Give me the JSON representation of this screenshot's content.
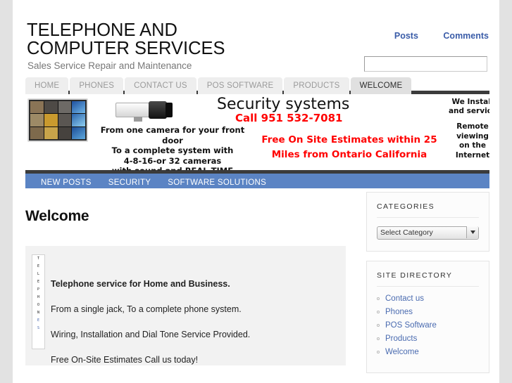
{
  "site": {
    "title": "TELEPHONE AND COMPUTER SERVICES",
    "tagline": "Sales Service Repair and Maintenance"
  },
  "meta_nav": {
    "posts": "Posts",
    "comments": "Comments"
  },
  "search": {
    "value": "",
    "placeholder": ""
  },
  "primary_nav": {
    "items": [
      {
        "label": "HOME",
        "active": false
      },
      {
        "label": "PHONES",
        "active": false
      },
      {
        "label": "CONTACT US",
        "active": false
      },
      {
        "label": "POS SOFTWARE",
        "active": false
      },
      {
        "label": "PRODUCTS",
        "active": false
      },
      {
        "label": "WELCOME",
        "active": true
      }
    ]
  },
  "banner": {
    "heading": "Security systems",
    "call": "Call 951 532-7081",
    "left_text": "From one camera for your front door\nTo a complete system with\n4-8-16-or 32 cameras\nwith sound and REAL TIME recording",
    "offer": "Free On Site Estimates within 25 Miles from Ontario California",
    "right_top": "We Install\nand service",
    "right_bottom": "Remote\nviewing\non the\nInternet",
    "colors": {
      "red": "#ff0000",
      "black": "#111111"
    }
  },
  "secondary_nav": {
    "items": [
      {
        "label": "NEW POSTS"
      },
      {
        "label": "SECURITY"
      },
      {
        "label": "SOFTWARE SOLUTIONS"
      }
    ],
    "color": "#5b84c4"
  },
  "main": {
    "page_title": "Welcome",
    "entry": {
      "broken_image_alt": "T\nE\nL\nE\nP\nH\nO\nN\nE\nS",
      "paragraphs": [
        "Telephone service for Home and Business.",
        "From a single jack, To a complete phone system.",
        "Wiring, Installation and Dial Tone Service Provided.",
        "Free On-Site Estimates Call us today!"
      ]
    }
  },
  "sidebar": {
    "categories": {
      "title": "CATEGORIES",
      "selected": "Select Category",
      "options": [
        "Select Category"
      ]
    },
    "site_directory": {
      "title": "SITE DIRECTORY",
      "links": [
        {
          "label": "Contact us"
        },
        {
          "label": "Phones"
        },
        {
          "label": "POS Software"
        },
        {
          "label": "Products"
        },
        {
          "label": "Welcome"
        }
      ]
    }
  }
}
